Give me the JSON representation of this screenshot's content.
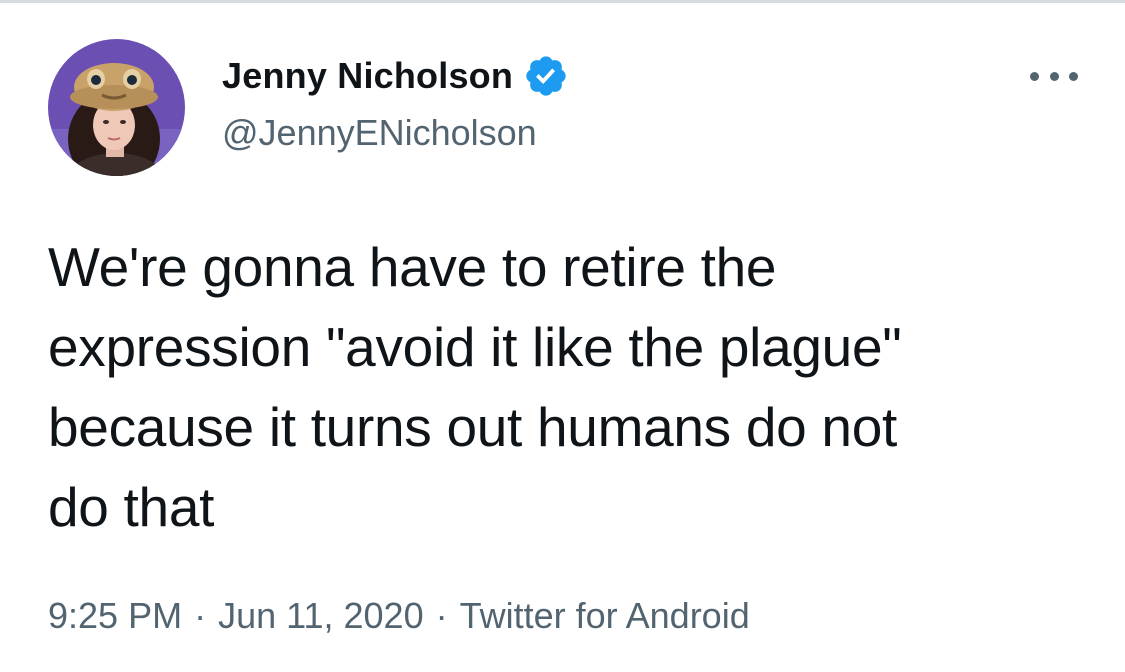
{
  "author": {
    "display_name": "Jenny Nicholson",
    "handle": "@JennyENicholson",
    "verified": true,
    "avatar_icon": "profile-photo"
  },
  "tweet": {
    "lines": [
      "We're gonna have to retire the",
      "expression \"avoid it like the plague\"",
      "because it turns out humans do not",
      "do that"
    ]
  },
  "meta": {
    "time": "9:25 PM",
    "separator": "·",
    "date": "Jun 11, 2020",
    "source": "Twitter for Android"
  },
  "colors": {
    "text_primary": "#0f1419",
    "text_secondary": "#536471",
    "verified_blue": "#1d9bf0",
    "avatar_bg": "#6a4fb0"
  },
  "icons": {
    "verified": "verified-badge-icon",
    "more": "more-options-icon"
  }
}
